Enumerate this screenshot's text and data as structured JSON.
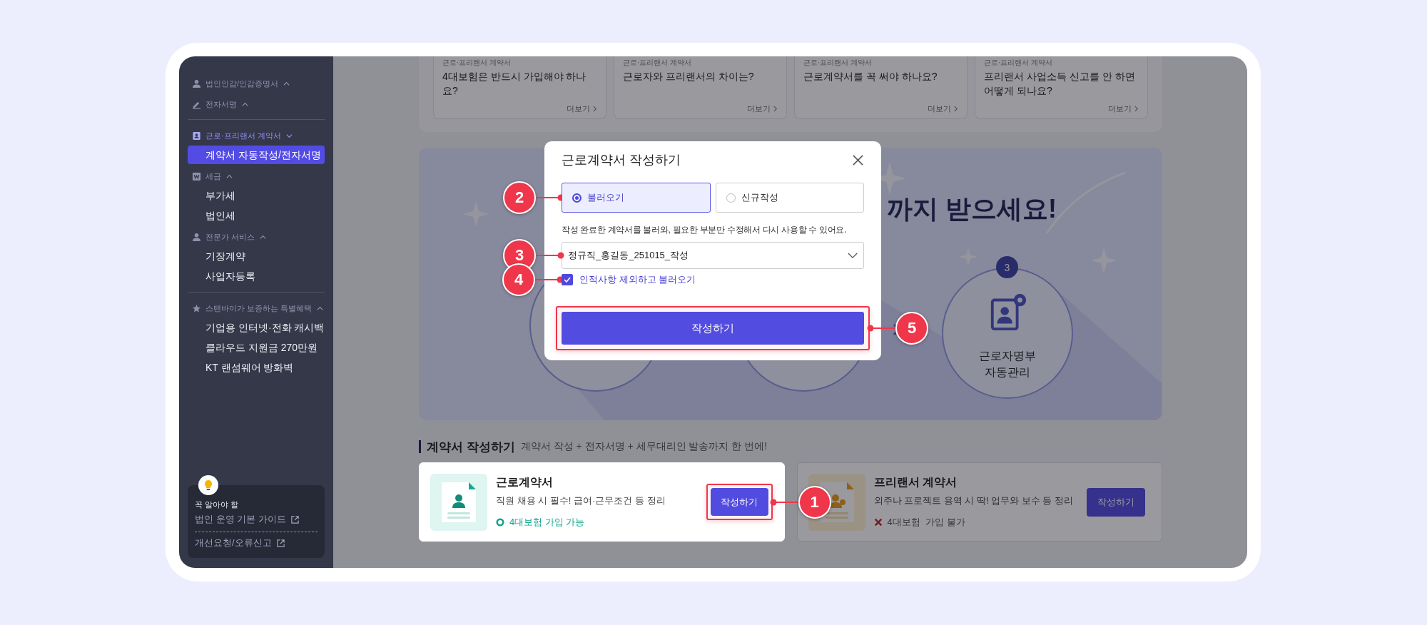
{
  "sidebar": {
    "sections": [
      {
        "groups": [
          {
            "label": "법인인감/인감증명서",
            "active": false
          },
          {
            "label": "전자서명",
            "active": false
          }
        ]
      },
      {
        "groups": [
          {
            "label": "근로·프리랜서 계약서",
            "active": true,
            "items": [
              {
                "label": "계약서 자동작성/전자서명",
                "selected": true
              }
            ]
          },
          {
            "label": "세금",
            "active": false,
            "items": [
              {
                "label": "부가세",
                "selected": false
              },
              {
                "label": "법인세",
                "selected": false
              }
            ]
          },
          {
            "label": "전문가 서비스",
            "active": false,
            "items": [
              {
                "label": "기장계약",
                "selected": false
              },
              {
                "label": "사업자등록",
                "selected": false
              }
            ]
          }
        ]
      },
      {
        "groups": [
          {
            "label": "스탠바이가 보증하는 특별혜택",
            "active": false,
            "items": [
              {
                "label": "기업용 인터넷·전화 캐시백",
                "selected": false
              },
              {
                "label": "클라우드 지원금 270만원",
                "selected": false
              },
              {
                "label": "KT 랜섬웨어 방화벽",
                "selected": false
              }
            ]
          }
        ]
      }
    ],
    "guide_box": {
      "caption": "꼭 알아야 할",
      "links": [
        "법인 운영 기본 가이드",
        "개선요청/오류신고"
      ]
    }
  },
  "faq_cards": [
    {
      "category": "근로·프리랜서 계약서",
      "question": "4대보험은 반드시 가입해야 하나요?",
      "more": "더보기"
    },
    {
      "category": "근로·프리랜서 계약서",
      "question": "근로자와 프리랜서의 차이는?",
      "more": "더보기"
    },
    {
      "category": "근로·프리랜서 계약서",
      "question": "근로계약서를 꼭 써야 하나요?",
      "more": "더보기"
    },
    {
      "category": "근로·프리랜서 계약서",
      "question": "프리랜서 사업소득 신고를 안 하면 어떻게 되나요?",
      "more": "더보기"
    }
  ],
  "banner": {
    "headline": "까지 받으세요!",
    "step": {
      "number": "3",
      "label_lines": [
        "근로자명부",
        "자동관리"
      ]
    }
  },
  "section": {
    "title": "계약서 작성하기",
    "subtitle": "계약서 작성 + 전자서명 + 세무대리인 발송까지 한 번에!"
  },
  "contract_cards": [
    {
      "title": "근로계약서",
      "description": "직원 채용 시 필수! 급여·근무조건 등 정리",
      "insurance": {
        "kind": "ok",
        "label": "4대보험 가입 가능"
      },
      "button": "작성하기",
      "focused": true,
      "callout": "1"
    },
    {
      "title": "프리랜서 계약서",
      "description": "외주나 프로젝트 용역 시 딱! 업무와 보수 등 정리",
      "insurance": {
        "kind": "no",
        "label": "4대보험  가입 불가"
      },
      "button": "작성하기",
      "focused": false
    }
  ],
  "modal": {
    "title": "근로계약서 작성하기",
    "options": [
      {
        "label": "불러오기",
        "selected": true
      },
      {
        "label": "신규작성",
        "selected": false
      }
    ],
    "description": "작성 완료한 계약서를 불러와, 필요한 부분만 수정해서 다시 사용할 수 있어요.",
    "select": {
      "value": "정규직_홍길동_251015_작성"
    },
    "checkbox": {
      "label": "인적사항 제외하고 불러오기",
      "checked": true
    },
    "submit": "작성하기",
    "callouts": {
      "options": "2",
      "select": "3",
      "checkbox": "4",
      "submit": "5"
    }
  }
}
